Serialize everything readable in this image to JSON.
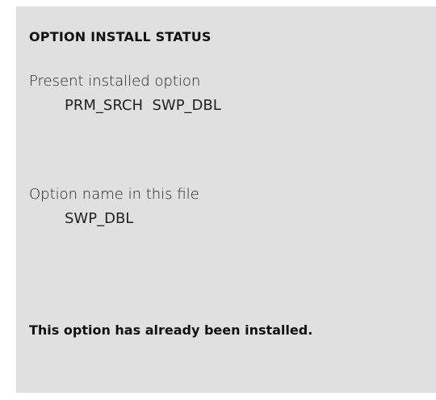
{
  "dialog": {
    "title": "OPTION INSTALL STATUS",
    "present": {
      "label": "Present installed option",
      "value": "PRM_SRCH  SWP_DBL"
    },
    "file": {
      "label": "Option name in this file",
      "value": "SWP_DBL"
    },
    "message": "This option has already been installed."
  },
  "colors": {
    "panel_background": "#e0e0e0",
    "text": "#101010"
  }
}
